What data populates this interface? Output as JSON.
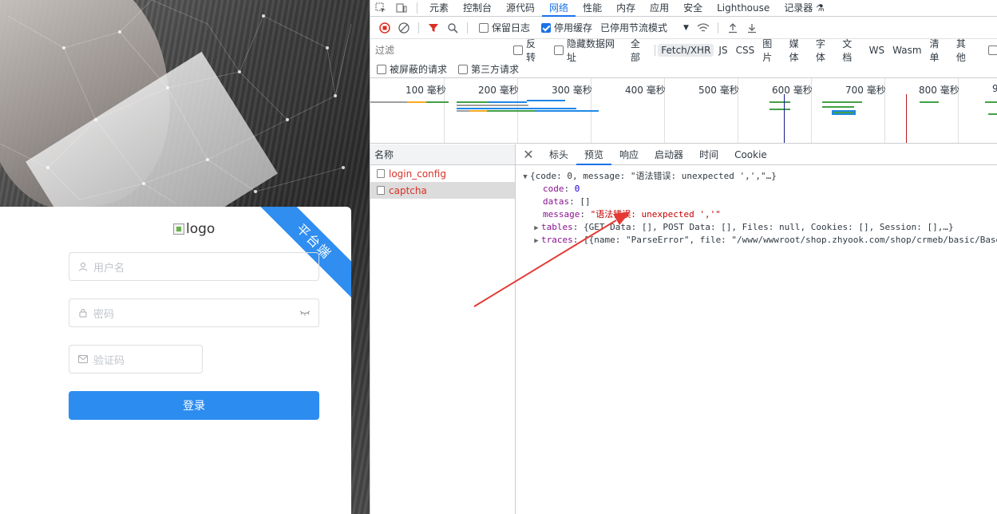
{
  "login": {
    "ribbon": "平台端",
    "logo_alt": "logo",
    "username_placeholder": "用户名",
    "password_placeholder": "密码",
    "captcha_placeholder": "验证码",
    "login_button": "登录"
  },
  "devtools": {
    "tabs": [
      "元素",
      "控制台",
      "源代码",
      "网络",
      "性能",
      "内存",
      "应用",
      "安全",
      "Lighthouse",
      "记录器"
    ],
    "active_tab": "网络",
    "toolbar": {
      "preserve_log": "保留日志",
      "disable_cache": "停用缓存",
      "throttle": "已停用节流模式"
    },
    "filter": {
      "placeholder": "过滤",
      "invert": "反转",
      "hide_data_urls": "隐藏数据网址",
      "all": "全部",
      "types": [
        "Fetch/XHR",
        "JS",
        "CSS",
        "图片",
        "媒体",
        "字体",
        "文档",
        "WS",
        "Wasm",
        "清单",
        "其他"
      ],
      "blocked_requests": "被屏蔽的请求",
      "third_party": "第三方请求"
    },
    "timeline_labels": [
      "100 毫秒",
      "200 毫秒",
      "300 毫秒",
      "400 毫秒",
      "500 毫秒",
      "600 毫秒",
      "700 毫秒",
      "800 毫秒",
      "9"
    ],
    "requests_header": "名称",
    "requests": [
      "login_config",
      "captcha"
    ],
    "detail_tabs": [
      "标头",
      "预览",
      "响应",
      "启动器",
      "时间",
      "Cookie"
    ],
    "active_detail_tab": "预览",
    "preview": {
      "summary": "{code: 0, message: \"语法错误: unexpected ',',\"…}",
      "code_key": "code",
      "code_val": "0",
      "datas_key": "datas",
      "datas_val": "[]",
      "message_key": "message",
      "message_val": "\"语法错误: unexpected ','\"",
      "tables_key": "tables",
      "tables_val": "{GET Data: [], POST Data: [], Files: null, Cookies: [], Session: [],…}",
      "traces_key": "traces",
      "traces_val": "[{name: \"ParseError\", file: \"/www/wwwroot/shop.zhyook.com/shop/crmeb/basic/Base"
    }
  },
  "colors": {
    "accent": "#2d8cf0",
    "ribbon": "#2f8ef0",
    "error_text": "#d93025",
    "arrow": "#e53935"
  }
}
